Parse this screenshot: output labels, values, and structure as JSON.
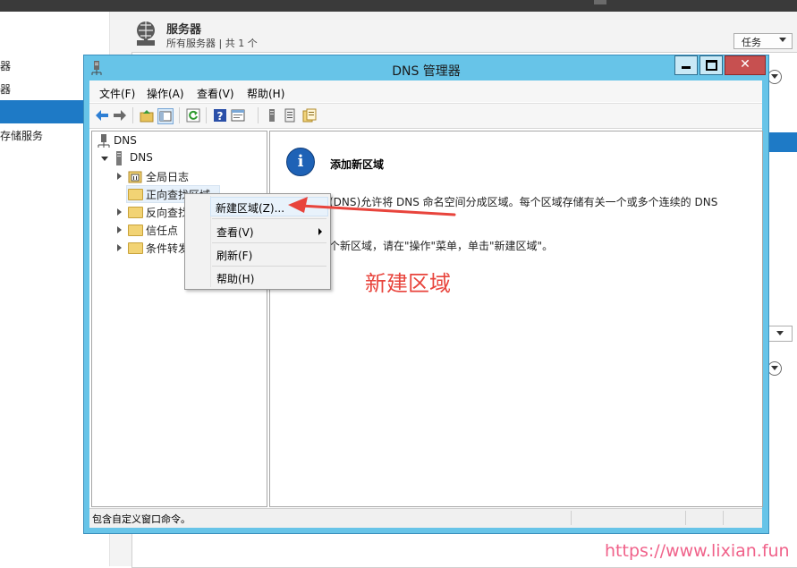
{
  "background": {
    "left_items": [
      "器",
      "器",
      "",
      "存储服务"
    ],
    "server_title": "服务器",
    "server_subtitle": "所有服务器 | 共 1 个",
    "tasks_label": "任务"
  },
  "window": {
    "title": "DNS 管理器"
  },
  "menubar": {
    "file": "文件(F)",
    "action": "操作(A)",
    "view": "查看(V)",
    "help": "帮助(H)"
  },
  "tree": {
    "root": "DNS",
    "server": "DNS",
    "items": [
      "全局日志",
      "正向查找区域",
      "反向查找",
      "信任点",
      "条件转发"
    ]
  },
  "detail": {
    "title": "添加新区域",
    "line1": "域名系统(DNS)允许将 DNS 命名空间分成区域。每个区域存储有关一个或多个连续的 DNS",
    "line2": "域。",
    "line3": "要添加一个新区域，请在\"操作\"菜单，单击\"新建区域\"。"
  },
  "context_menu": {
    "new_zone": "新建区域(Z)...",
    "view": "查看(V)",
    "refresh": "刷新(F)",
    "help": "帮助(H)"
  },
  "statusbar": {
    "text": "包含自定义窗口命令。"
  },
  "annotation": {
    "label": "新建区域",
    "watermark": "https://www.lixian.fun",
    "arrow_color": "#e8443c"
  },
  "colors": {
    "window_frame": "#67c4e8",
    "selection_blue": "#1e7ac6",
    "close_button": "#c75050"
  }
}
